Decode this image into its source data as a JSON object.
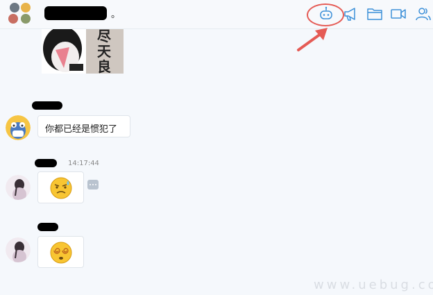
{
  "header": {
    "title_suffix": "。",
    "tools": [
      "robot-icon",
      "megaphone-icon",
      "folder-icon",
      "video-icon",
      "members-icon"
    ]
  },
  "sticker": {
    "chars": [
      "尽",
      "天",
      "良"
    ]
  },
  "messages": [
    {
      "text": "你都已经是惯犯了"
    },
    {
      "time": "14:17:44"
    }
  ],
  "watermark": "www.uebug.com",
  "colors": {
    "accent": "#3b8fd8",
    "annotation": "#e55b55"
  }
}
